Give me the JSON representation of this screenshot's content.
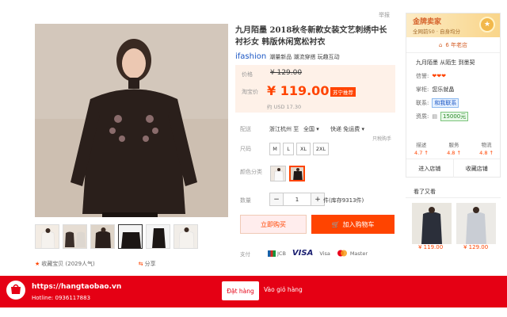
{
  "report_label": "举报",
  "product": {
    "title": "九月陌墨 2018秋冬新款女装文艺刺绣中长衬衫女 韩版休闲宽松衬衣",
    "brand_logo": "ifashion",
    "brand_tags": "潮量新品 潮流穿搭 玩趣互动"
  },
  "price": {
    "label_price": "价格",
    "old_price": "¥ 129.00",
    "label_taobao": "淘宝价",
    "new_price": "¥ 119.00",
    "badge": "苏宁推荐",
    "usd": "约 USD 17.30"
  },
  "delivery": {
    "label": "配送",
    "from": "浙江杭州 至",
    "dest": "全国 ▾",
    "express": "快递 免运费 ▾",
    "note": "只税购手"
  },
  "size": {
    "label": "尺码",
    "options": [
      "M",
      "L",
      "XL",
      "2XL"
    ]
  },
  "color": {
    "label": "颜色分类"
  },
  "quantity": {
    "label": "数量",
    "minus": "−",
    "value": "1",
    "plus": "+",
    "stock": "件(库存9313件)"
  },
  "actions": {
    "buy_now": "立即购买",
    "add_cart": "加入购物车"
  },
  "payment": {
    "label": "支付",
    "jcb": "JCB",
    "visa": "VISA",
    "visa_text": "Visa",
    "master": "Master"
  },
  "share": {
    "fav": "收藏宝贝 (2029人气)",
    "share": "分享"
  },
  "shop": {
    "gold_title": "金牌卖家",
    "gold_sub": "全网前50 · 自身均分",
    "years": "6 年老店",
    "name": "九月陌墨 从陌生 到墨契",
    "credit_label": "信誉:",
    "credit": "❤❤❤",
    "biz_label": "掌柜:",
    "biz": "您乐就晶",
    "contact_label": "联系:",
    "contact": "和我联系",
    "qual_label": "资质:",
    "qual": "15000元",
    "scores": [
      {
        "label": "描述",
        "value": "4.7 ↑"
      },
      {
        "label": "服务",
        "value": "4.8 ↑"
      },
      {
        "label": "物流",
        "value": "4.8 ↑"
      }
    ],
    "enter": "进入店铺",
    "collect": "收藏店铺"
  },
  "seen": {
    "title": "看了又看",
    "prices": [
      "¥ 119.00",
      "¥ 129.00"
    ]
  },
  "footer": {
    "site": "https://hangtaobao.vn",
    "hotline": "Hotline: 0936117883",
    "order": "Đặt hàng",
    "cart": "Vào giỏ hàng"
  }
}
